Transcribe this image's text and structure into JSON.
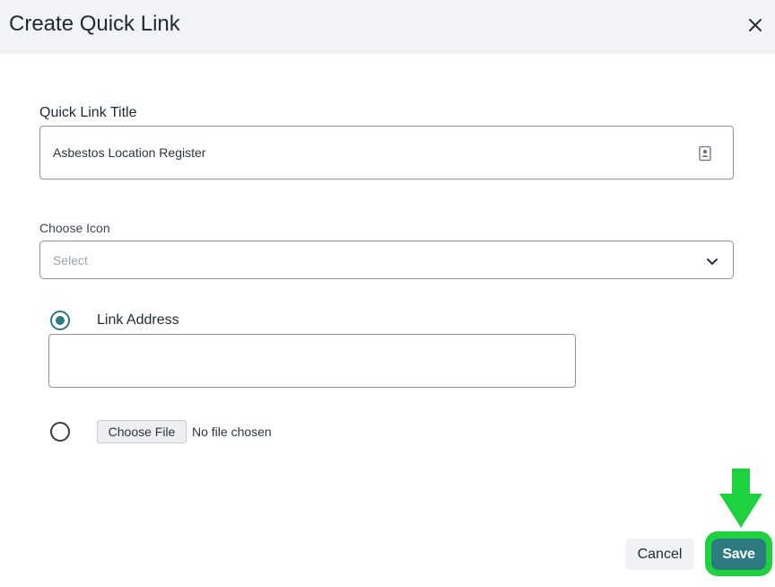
{
  "dialog": {
    "title": "Create Quick Link",
    "close_icon": "close-icon"
  },
  "form": {
    "quick_link_title": {
      "label": "Quick Link Title",
      "value": "Asbestos Location Register",
      "icon": "contact-card-icon"
    },
    "choose_icon": {
      "label": "Choose Icon",
      "placeholder": "Select",
      "icon": "chevron-down-icon"
    },
    "link_address": {
      "label": "Link Address",
      "selected": true,
      "value": ""
    },
    "file_option": {
      "selected": false,
      "button_label": "Choose File",
      "status": "No file chosen"
    }
  },
  "actions": {
    "cancel_label": "Cancel",
    "save_label": "Save"
  },
  "annotation": {
    "arrow_icon": "down-arrow-icon",
    "highlight_color": "#1ed23f"
  },
  "colors": {
    "accent": "#2b7b80",
    "header_bg": "#f1f3f6",
    "border": "#8c9298"
  }
}
